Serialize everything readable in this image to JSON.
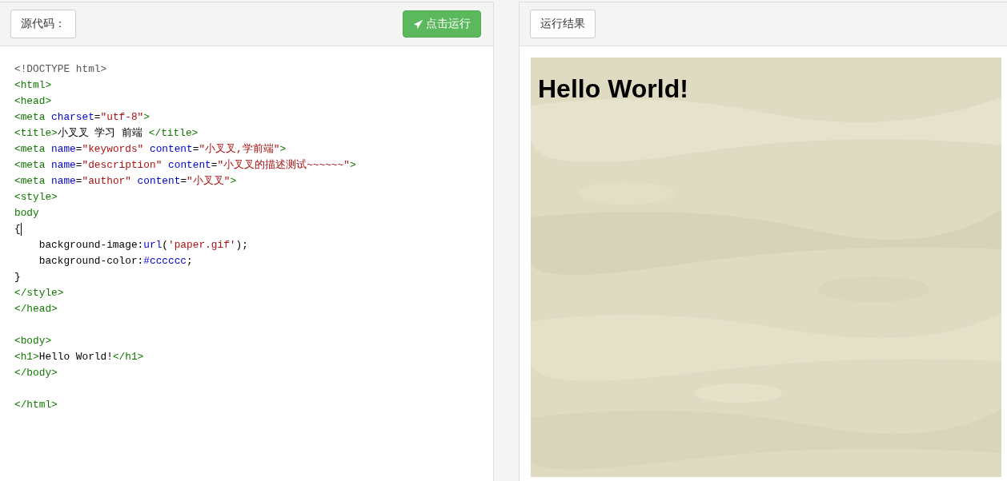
{
  "source_panel": {
    "label": "源代码：",
    "run_button": "点击运行"
  },
  "code_lines": [
    {
      "kind": "code",
      "tokens": [
        {
          "kind": "doctype",
          "text": "<!DOCTYPE html>"
        }
      ]
    },
    {
      "kind": "code",
      "tokens": [
        {
          "kind": "tag",
          "text": "<html>"
        }
      ]
    },
    {
      "kind": "code",
      "tokens": [
        {
          "kind": "tag",
          "text": "<head>"
        }
      ]
    },
    {
      "kind": "code",
      "tokens": [
        {
          "kind": "tag",
          "text": "<meta"
        },
        {
          "kind": "attr",
          "text": " charset"
        },
        {
          "kind": "plain",
          "text": "="
        },
        {
          "kind": "str",
          "text": "\"utf-8\""
        },
        {
          "kind": "tag",
          "text": ">"
        }
      ]
    },
    {
      "kind": "code",
      "tokens": [
        {
          "kind": "tag",
          "text": "<title>"
        },
        {
          "kind": "plain",
          "text": "小叉叉 学习 前端 "
        },
        {
          "kind": "tag",
          "text": "</title>"
        }
      ]
    },
    {
      "kind": "code",
      "tokens": [
        {
          "kind": "tag",
          "text": "<meta"
        },
        {
          "kind": "attr",
          "text": " name"
        },
        {
          "kind": "plain",
          "text": "="
        },
        {
          "kind": "str",
          "text": "\"keywords\""
        },
        {
          "kind": "attr",
          "text": " content"
        },
        {
          "kind": "plain",
          "text": "="
        },
        {
          "kind": "str",
          "text": "\"小叉叉,学前端\""
        },
        {
          "kind": "tag",
          "text": ">"
        }
      ]
    },
    {
      "kind": "code",
      "tokens": [
        {
          "kind": "tag",
          "text": "<meta"
        },
        {
          "kind": "attr",
          "text": " name"
        },
        {
          "kind": "plain",
          "text": "="
        },
        {
          "kind": "str",
          "text": "\"description\""
        },
        {
          "kind": "attr",
          "text": " content"
        },
        {
          "kind": "plain",
          "text": "="
        },
        {
          "kind": "str",
          "text": "\"小叉叉的描述测试~~~~~~\""
        },
        {
          "kind": "tag",
          "text": ">"
        }
      ]
    },
    {
      "kind": "code",
      "tokens": [
        {
          "kind": "tag",
          "text": "<meta"
        },
        {
          "kind": "attr",
          "text": " name"
        },
        {
          "kind": "plain",
          "text": "="
        },
        {
          "kind": "str",
          "text": "\"author\""
        },
        {
          "kind": "attr",
          "text": " content"
        },
        {
          "kind": "plain",
          "text": "="
        },
        {
          "kind": "str",
          "text": "\"小叉叉\""
        },
        {
          "kind": "tag",
          "text": ">"
        }
      ]
    },
    {
      "kind": "code",
      "tokens": [
        {
          "kind": "tag",
          "text": "<style>"
        }
      ]
    },
    {
      "kind": "code",
      "tokens": [
        {
          "kind": "tag",
          "text": "body"
        }
      ]
    },
    {
      "kind": "code",
      "cursor": true,
      "tokens": [
        {
          "kind": "plain",
          "text": "{"
        }
      ]
    },
    {
      "kind": "code",
      "tokens": [
        {
          "kind": "plain",
          "text": "    background-image:"
        },
        {
          "kind": "attr",
          "text": "url"
        },
        {
          "kind": "plain",
          "text": "("
        },
        {
          "kind": "str",
          "text": "'paper.gif'"
        },
        {
          "kind": "plain",
          "text": ");"
        }
      ]
    },
    {
      "kind": "code",
      "tokens": [
        {
          "kind": "plain",
          "text": "    background-color:"
        },
        {
          "kind": "attr",
          "text": "#cccccc"
        },
        {
          "kind": "plain",
          "text": ";"
        }
      ]
    },
    {
      "kind": "code",
      "tokens": [
        {
          "kind": "plain",
          "text": "}"
        }
      ]
    },
    {
      "kind": "code",
      "tokens": [
        {
          "kind": "tag",
          "text": "</style>"
        }
      ]
    },
    {
      "kind": "code",
      "tokens": [
        {
          "kind": "tag",
          "text": "</head>"
        }
      ]
    },
    {
      "kind": "blank"
    },
    {
      "kind": "code",
      "tokens": [
        {
          "kind": "tag",
          "text": "<body>"
        }
      ]
    },
    {
      "kind": "code",
      "tokens": [
        {
          "kind": "tag",
          "text": "<h1>"
        },
        {
          "kind": "plain",
          "text": "Hello World!"
        },
        {
          "kind": "tag",
          "text": "</h1>"
        }
      ]
    },
    {
      "kind": "code",
      "tokens": [
        {
          "kind": "tag",
          "text": "</body>"
        }
      ]
    },
    {
      "kind": "blank"
    },
    {
      "kind": "code",
      "tokens": [
        {
          "kind": "tag",
          "text": "</html>"
        }
      ]
    }
  ],
  "result_panel": {
    "label": "运行结果",
    "heading": "Hello World!"
  }
}
